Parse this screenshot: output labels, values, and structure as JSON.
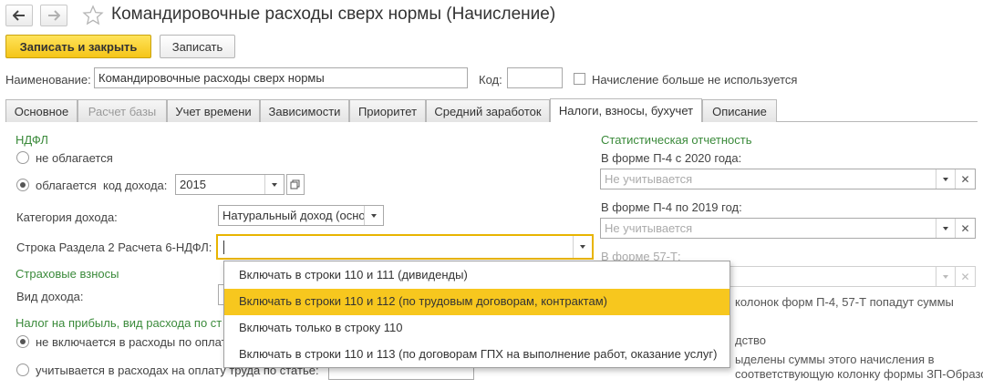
{
  "header": {
    "title": "Командировочные расходы сверх нормы (Начисление)"
  },
  "toolbar": {
    "save_close_label": "Записать и закрыть",
    "save_label": "Записать"
  },
  "form": {
    "name_label": "Наименование:",
    "name_value": "Командировочные расходы сверх нормы",
    "code_label": "Код:",
    "code_value": "",
    "inactive_label": "Начисление больше не используется"
  },
  "tabs": [
    {
      "label": "Основное"
    },
    {
      "label": "Расчет базы"
    },
    {
      "label": "Учет времени"
    },
    {
      "label": "Зависимости"
    },
    {
      "label": "Приоритет"
    },
    {
      "label": "Средний заработок"
    },
    {
      "label": "Налоги, взносы, бухучет"
    },
    {
      "label": "Описание"
    }
  ],
  "ndfl": {
    "section_title": "НДФЛ",
    "not_taxed_label": "не облагается",
    "taxed_label": "облагается",
    "income_code_label": "код дохода:",
    "income_code_value": "2015",
    "income_category_label": "Категория дохода:",
    "income_category_value": "Натуральный доход (осно",
    "section2_label": "Строка Раздела 2 Расчета 6-НДФЛ:",
    "section2_value": ""
  },
  "insurance": {
    "section_title": "Страховые взносы",
    "income_type_label": "Вид дохода:"
  },
  "profit_tax": {
    "section_title": "Налог на прибыль, вид расхода по ст",
    "opt_not_included": "не включается в расходы по оплат",
    "opt_included": "учитывается в расходах на оплату труда по статье:"
  },
  "stats": {
    "section_title": "Статистическая отчетность",
    "p4_2020_label": "В форме П-4 с 2020 года:",
    "p4_2020_placeholder": "Не учитывается",
    "p4_2019_label": "В форме П-4 по 2019 год:",
    "p4_2019_placeholder": "Не учитывается",
    "f57t_label": "В форме 57-Т:",
    "note1": "колонок форм П-4, 57-Т попадут суммы",
    "section_tail": "дство",
    "note2_line1": "ыделены суммы этого начисления в",
    "note2_line2": "соответствующую колонку формы ЗП-Образование"
  },
  "dropdown": {
    "items": [
      {
        "label": "Включать в строки 110 и 111 (дивиденды)"
      },
      {
        "label": "Включать в строки 110 и 112 (по трудовым договорам, контрактам)"
      },
      {
        "label": "Включать только в строку 110"
      },
      {
        "label": "Включать в строки 110 и 113 (по договорам ГПХ на выполнение работ, оказание услуг)"
      }
    ],
    "selected_index": 1
  },
  "colors": {
    "accent_yellow": "#f7c71e",
    "section_green": "#3a8a3a",
    "focus_border": "#e8b400"
  }
}
